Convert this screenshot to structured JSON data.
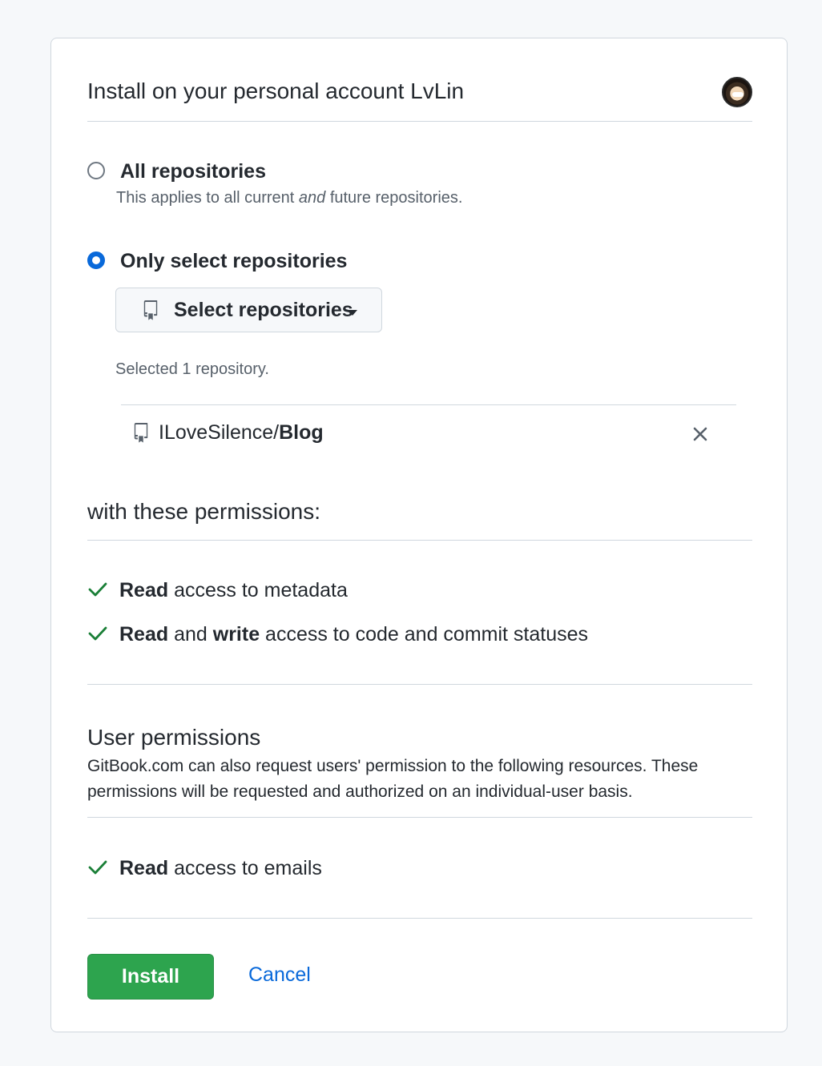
{
  "header": {
    "title": "Install on your personal account LvLin"
  },
  "repo_scope": {
    "all": {
      "label": "All repositories",
      "note_before": "This applies to all current ",
      "note_em": "and",
      "note_after": " future repositories.",
      "checked": false
    },
    "selected": {
      "label": "Only select repositories",
      "checked": true
    },
    "select_button_label": "Select repositories",
    "selected_count": "Selected 1 repository.",
    "repositories": [
      {
        "owner": "ILoveSilence/",
        "name": "Blog"
      }
    ]
  },
  "permissions": {
    "title": "with these permissions:",
    "items": [
      {
        "bold1": "Read",
        "mid": "",
        "bold2": "",
        "rest": " access to metadata"
      },
      {
        "bold1": "Read",
        "mid": " and ",
        "bold2": "write",
        "rest": " access to code and commit statuses"
      }
    ]
  },
  "user_permissions": {
    "title": "User permissions",
    "description": "GitBook.com can also request users' permission to the following resources. These permissions will be requested and authorized on an individual-user basis.",
    "items": [
      {
        "bold1": "Read",
        "rest": " access to emails"
      }
    ]
  },
  "actions": {
    "install_label": "Install",
    "cancel_label": "Cancel"
  },
  "colors": {
    "accent": "#0969da",
    "success": "#2da44e",
    "check": "#1a7f37",
    "border": "#d0d7de"
  },
  "icons": {
    "repo": "repo-icon",
    "remove": "x-icon",
    "check": "check-icon",
    "caret": "triangle-down-icon"
  }
}
